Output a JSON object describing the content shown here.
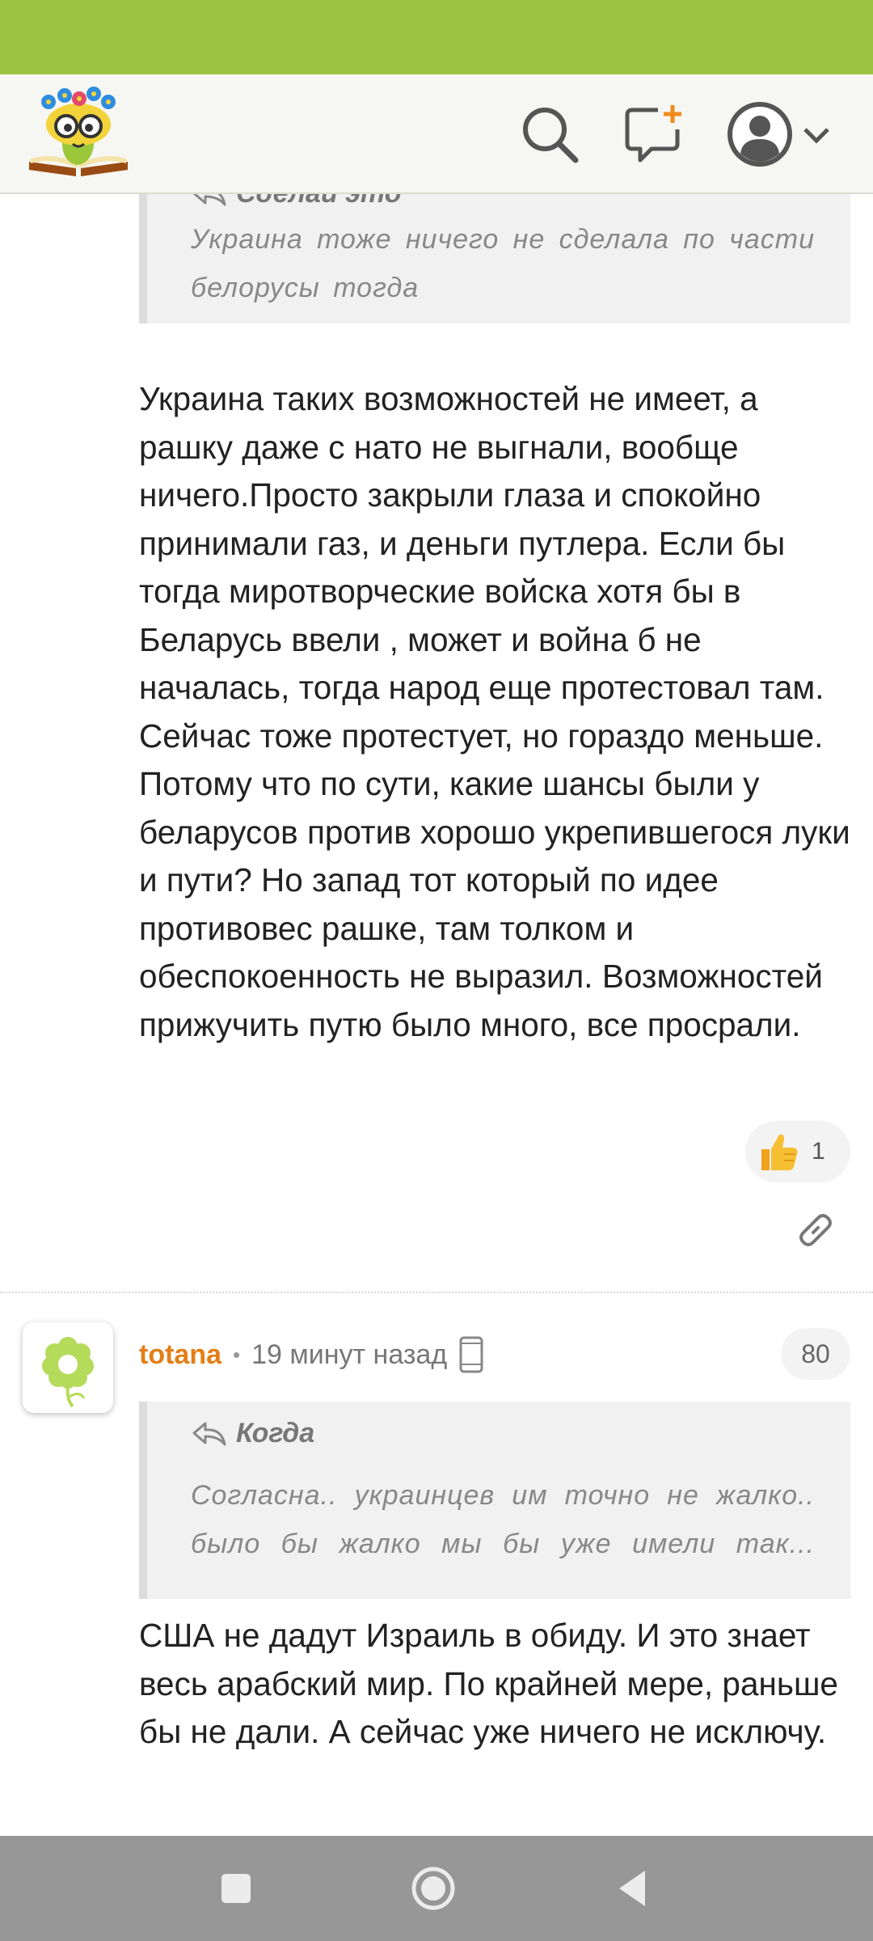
{
  "top_quote": {
    "author_partial": "Сделай это",
    "lines": [
      "Украина тоже ничего не сделала по части",
      "белорусы тогда"
    ]
  },
  "first_comment": {
    "text": "Украина таких возможностей не имеет, а рашку даже с нато не выгнали, вообще ничего.Просто закрыли глаза и спокойно принимали газ, и деньги путлера. Если бы тогда миротворческие войска хотя бы в Беларусь ввели , может и война б не началась, тогда народ еще протестовал там. Сейчас тоже протестует, но гораздо меньше. Потому что по сути, какие шансы были у беларусов против хорошо укрепившегося луки и пути? Но запад тот который по идее противовес рашке, там толком и обеспокоенность не выразил. Возможностей прижучить путю было много, все просрали.",
    "like_count": "1"
  },
  "second_comment": {
    "username": "totana",
    "separator": "•",
    "time": "19 минут назад",
    "rating": "80",
    "quote": {
      "author": "Когда",
      "lines": [
        "Согласна.. украинцев им точно не жалко..",
        "было бы жалко мы бы уже имели так..."
      ]
    },
    "text": "США не дадут Израиль в обиду. И это знает весь арабский мир. По крайней мере, раньше бы не дали. А сейчас уже ничего не исключу."
  },
  "colors": {
    "status_bar": "#9dc343",
    "username": "#e57e16",
    "header_bg": "#f6f6f2",
    "nav_bar": "#979797"
  },
  "icons": [
    "site-logo",
    "search-icon",
    "new-message-icon",
    "user-avatar-icon",
    "chevron-down-icon",
    "thumbs-up-icon",
    "link-icon",
    "mobile-phone-icon",
    "nav-recent-apps-icon",
    "nav-home-icon",
    "nav-back-icon"
  ]
}
